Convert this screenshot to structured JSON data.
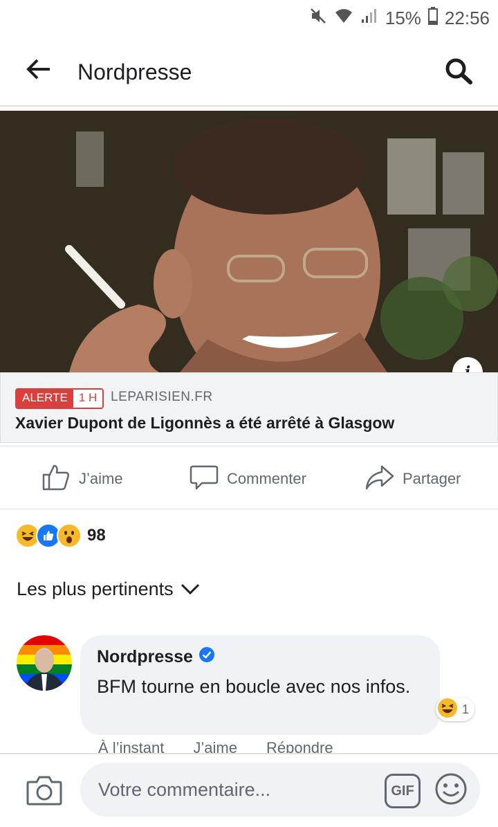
{
  "status": {
    "battery": "15%",
    "time": "22:56"
  },
  "header": {
    "title": "Nordpresse"
  },
  "post": {
    "badge_label": "ALERTE",
    "badge_time": "1 H",
    "domain": "LEPARISIEN.FR",
    "headline": "Xavier Dupont de Ligonnès a été arrêté à Glasgow",
    "info_icon": "i"
  },
  "actions": {
    "like": "J’aime",
    "comment": "Commenter",
    "share": "Partager"
  },
  "reactions": {
    "count": "98",
    "icons": [
      "haha",
      "like",
      "wow"
    ]
  },
  "sort": {
    "label": "Les plus pertinents"
  },
  "comment": {
    "author": "Nordpresse",
    "text": "BFM tourne en boucle avec nos infos.",
    "reaction_count": "1",
    "time": "À l’instant",
    "like": "J’aime",
    "reply": "Répondre"
  },
  "composer": {
    "placeholder": "Votre commentaire...",
    "gif": "GIF"
  },
  "colors": {
    "alert": "#d93f3c",
    "like_blue": "#1877f2",
    "text": "#1c1e21",
    "muted": "#606770"
  }
}
